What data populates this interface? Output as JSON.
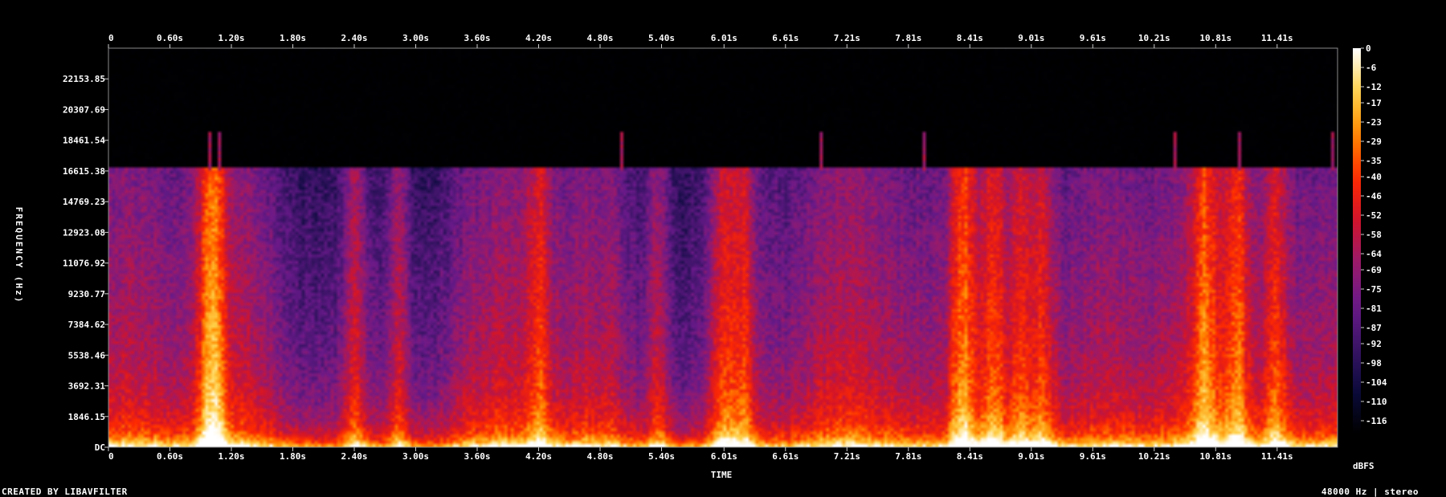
{
  "chart_data": {
    "type": "heatmap",
    "title": "",
    "xlabel": "TIME",
    "ylabel": "FREQUENCY (Hz)",
    "x_tick_labels": [
      "0",
      "0.60s",
      "1.20s",
      "1.80s",
      "2.40s",
      "3.00s",
      "3.60s",
      "4.20s",
      "4.80s",
      "5.40s",
      "6.01s",
      "6.61s",
      "7.21s",
      "7.81s",
      "8.41s",
      "9.01s",
      "9.61s",
      "10.21s",
      "10.81s",
      "11.41s"
    ],
    "x_ticks_s": [
      0,
      0.6,
      1.2,
      1.8,
      2.4,
      3.0,
      3.6,
      4.2,
      4.8,
      5.4,
      6.01,
      6.61,
      7.21,
      7.81,
      8.41,
      9.01,
      9.61,
      10.21,
      10.81,
      11.41
    ],
    "xlim": [
      0,
      12.0
    ],
    "y_tick_labels": [
      "DC",
      "1846.15",
      "3692.31",
      "5538.46",
      "7384.62",
      "9230.77",
      "11076.92",
      "12923.08",
      "14769.23",
      "16615.38",
      "18461.54",
      "20307.69",
      "22153.85"
    ],
    "y_ticks_hz": [
      0,
      1846.15,
      3692.31,
      5538.46,
      7384.62,
      9230.77,
      11076.92,
      12923.08,
      14769.23,
      16615.38,
      18461.54,
      20307.69,
      22153.85
    ],
    "ylim": [
      0,
      24000
    ],
    "colorbar": {
      "label": "dBFS",
      "tick_labels": [
        "0",
        "-6",
        "-12",
        "-17",
        "-23",
        "-29",
        "-35",
        "-40",
        "-46",
        "-52",
        "-58",
        "-64",
        "-69",
        "-75",
        "-81",
        "-87",
        "-92",
        "-98",
        "-104",
        "-110",
        "-116"
      ],
      "ticks": [
        0,
        -6,
        -12,
        -17,
        -23,
        -29,
        -35,
        -40,
        -46,
        -52,
        -58,
        -64,
        -69,
        -75,
        -81,
        -87,
        -92,
        -98,
        -104,
        -110,
        -116
      ],
      "range": [
        -120,
        0
      ],
      "colors": [
        "#000000",
        "#0a0a3c",
        "#3a1466",
        "#6a1a8a",
        "#9a1a6a",
        "#d2142a",
        "#ff2a00",
        "#ff8a00",
        "#ffd24a",
        "#ffffff"
      ]
    },
    "spectral_cutoff_hz": 16800,
    "loud_times_s": [
      0.97,
      1.06,
      2.4,
      2.83,
      4.2,
      5.36,
      6.01,
      6.2,
      8.35,
      8.65,
      8.9,
      9.1,
      10.7,
      11.02,
      11.4
    ],
    "spike_times_s": [
      0.97,
      1.06,
      5.0,
      6.94,
      7.95,
      10.41,
      11.02,
      11.95
    ],
    "footer_left": "CREATED BY LIBAVFILTER",
    "footer_right": "48000 Hz | stereo"
  }
}
